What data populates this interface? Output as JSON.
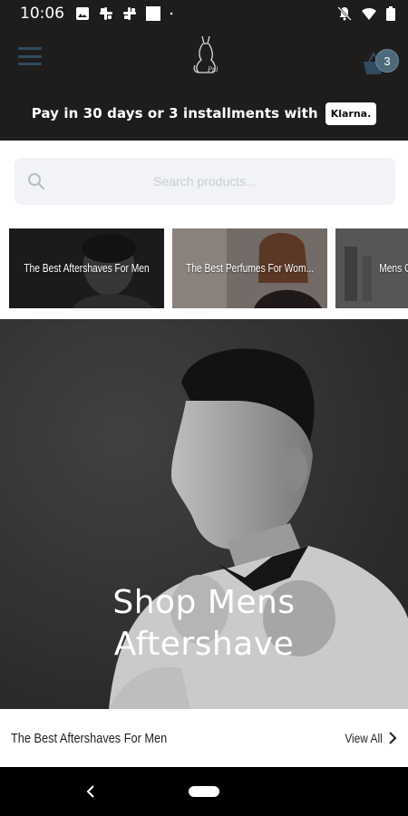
{
  "status_bar": {
    "time": "10:06",
    "left_icons": [
      "photo-icon",
      "slack-icon",
      "slack-icon",
      "square-icon",
      "dot-icon"
    ],
    "right_icons": [
      "notifications-off-icon",
      "wifi-icon",
      "battery-icon"
    ]
  },
  "header": {
    "menu_icon": "hamburger-menu-icon",
    "logo_icon": "cat-logo-icon",
    "cart_icon": "basket-icon",
    "cart_count": "3",
    "klarna": {
      "text": "Pay in 30 days or 3 installments with",
      "badge": "Klarna."
    }
  },
  "search": {
    "placeholder": "Search products...",
    "value": ""
  },
  "categories": [
    {
      "label": "The Best Aftershaves For Men"
    },
    {
      "label": "The Best Perfumes For Wom..."
    },
    {
      "label": "Mens C"
    }
  ],
  "hero": {
    "title_line1": "Shop Mens",
    "title_line2": "Aftershave"
  },
  "section": {
    "title": "The Best Aftershaves For Men",
    "view_all": "View All"
  },
  "colors": {
    "header_bg": "#1f1c1c",
    "accent": "#2f4b5f",
    "badge": "#4d6a7a"
  }
}
